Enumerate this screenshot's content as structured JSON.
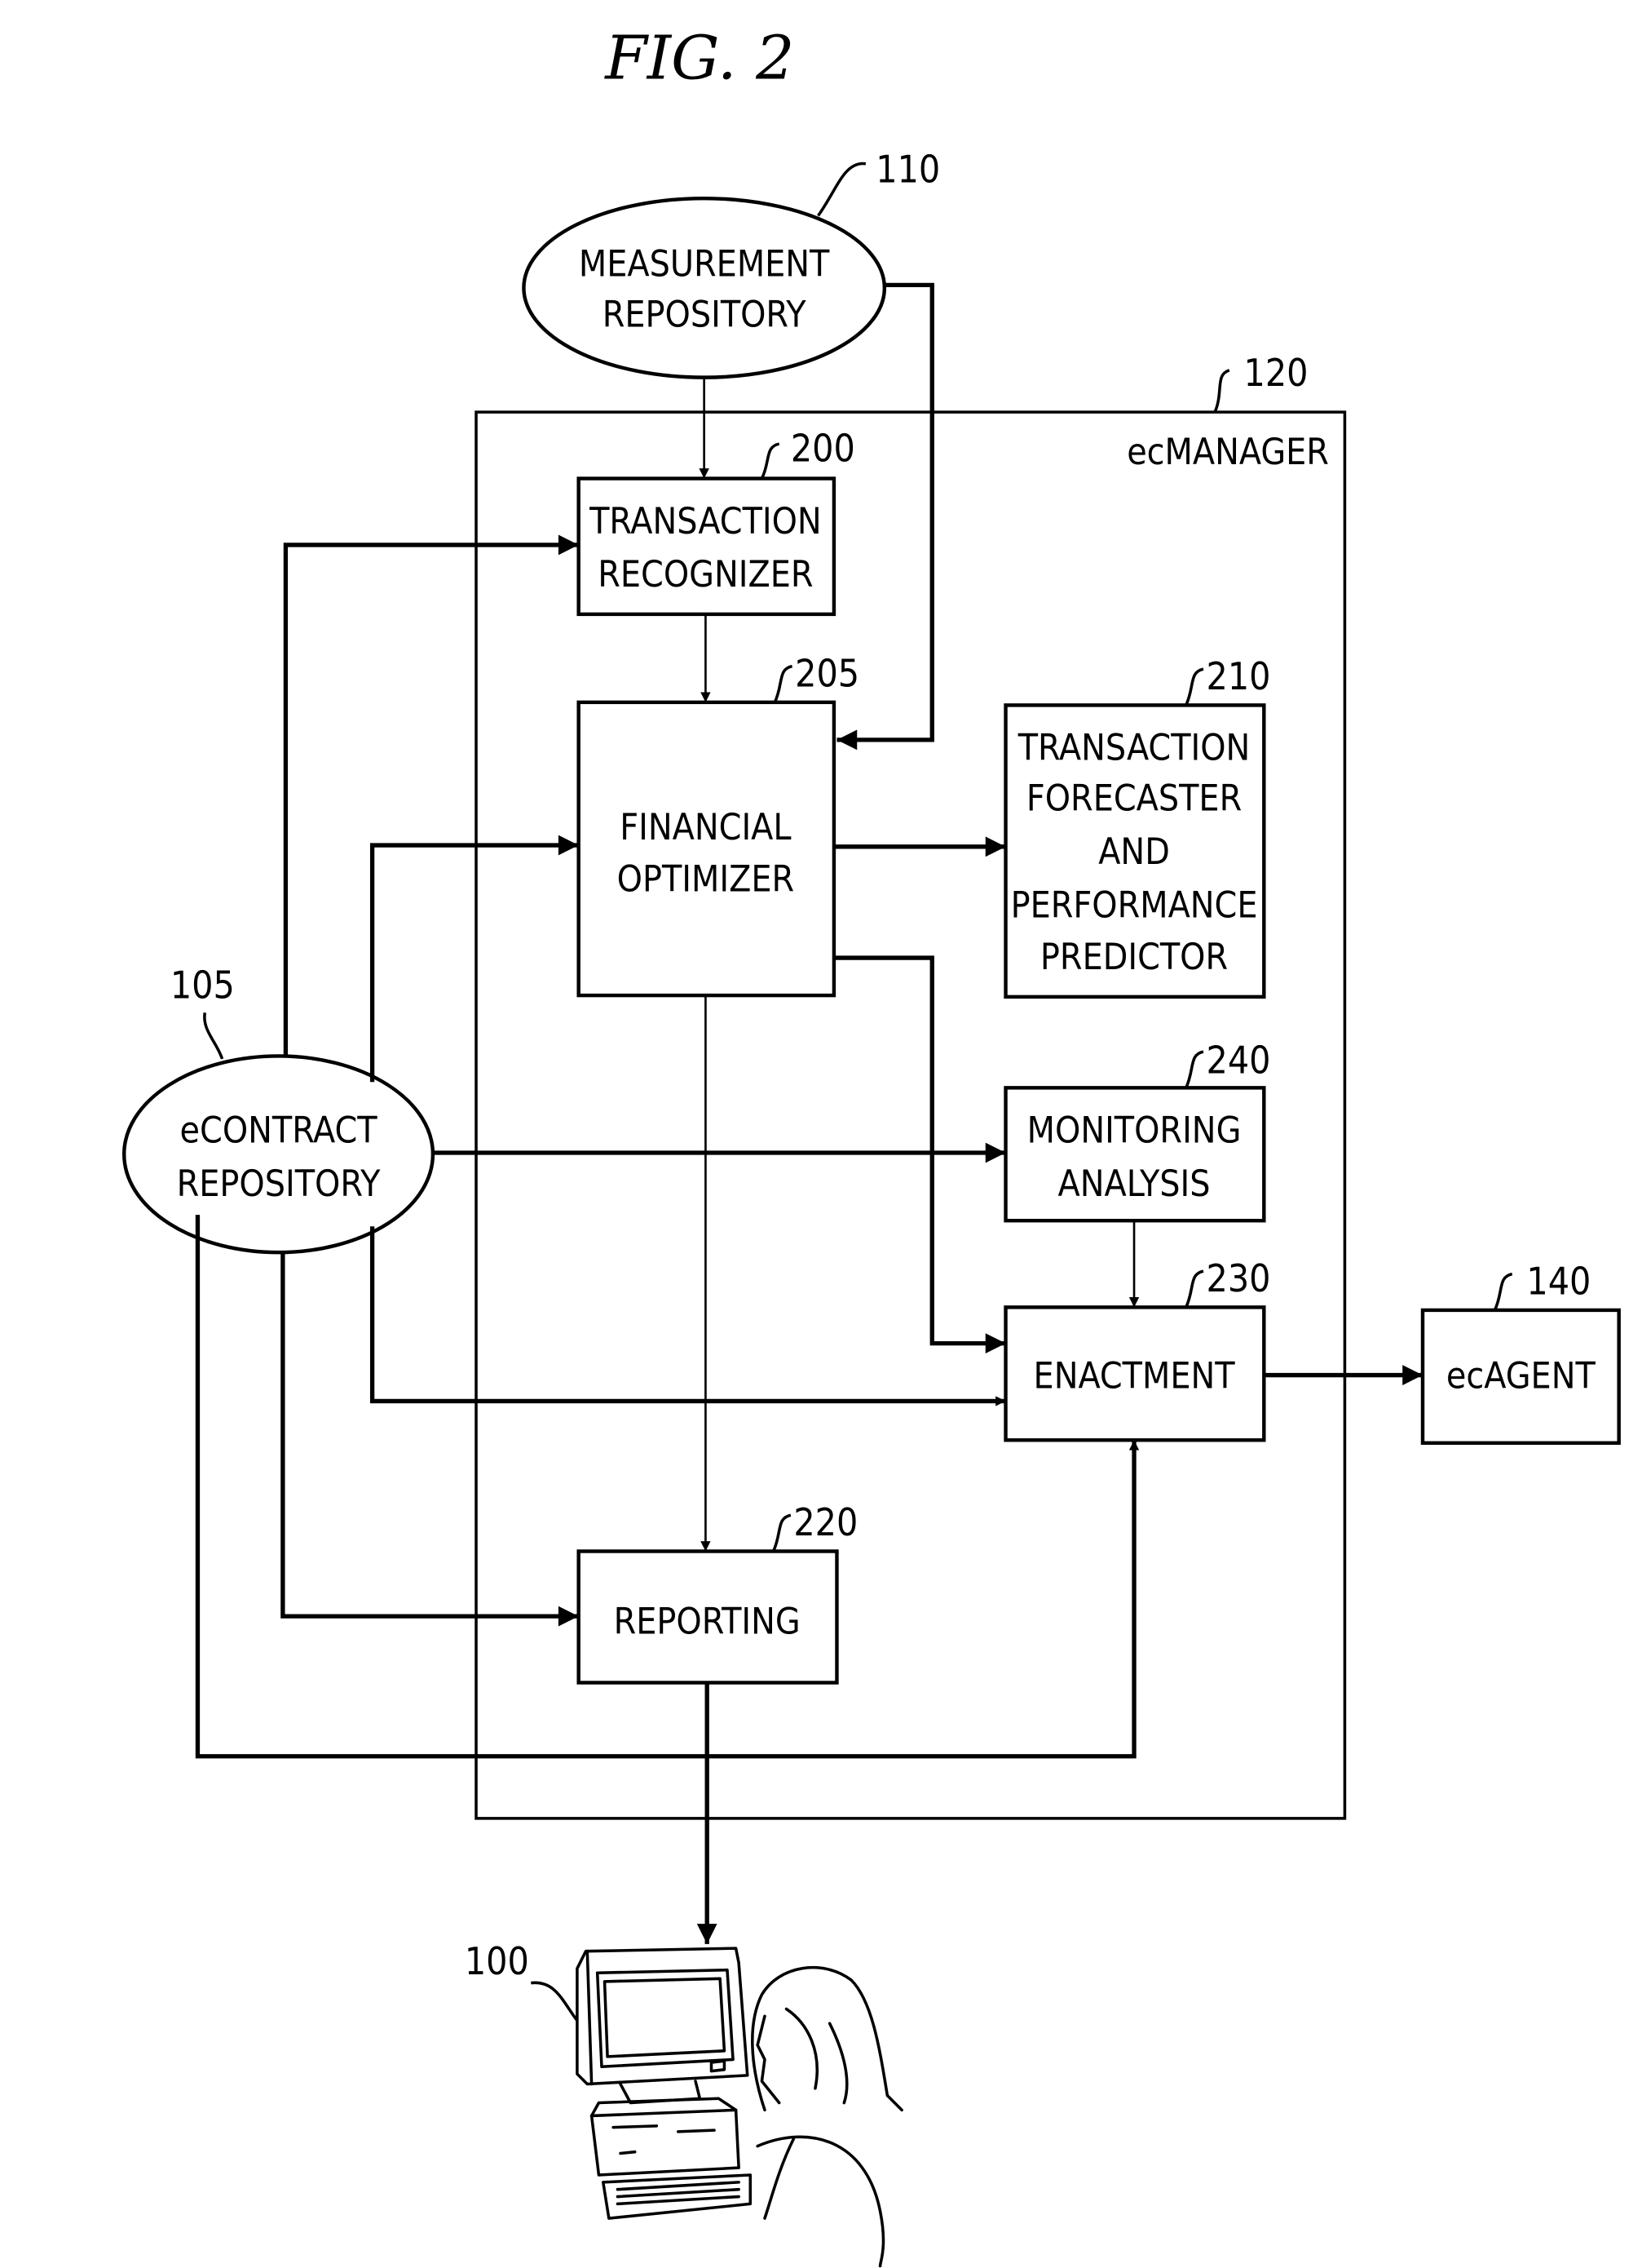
{
  "figure": {
    "title": "FIG. 2"
  },
  "nodes": {
    "measurement_repository": {
      "ref": "110",
      "lines": [
        "MEASUREMENT",
        "REPOSITORY"
      ]
    },
    "ecmanager": {
      "ref": "120",
      "label": "ecMANAGER"
    },
    "transaction_recognizer": {
      "ref": "200",
      "lines": [
        "TRANSACTION",
        "RECOGNIZER"
      ]
    },
    "financial_optimizer": {
      "ref": "205",
      "lines": [
        "FINANCIAL",
        "OPTIMIZER"
      ]
    },
    "transaction_forecaster": {
      "ref": "210",
      "lines": [
        "TRANSACTION",
        "FORECASTER",
        "AND",
        "PERFORMANCE",
        "PREDICTOR"
      ]
    },
    "monitoring_analysis": {
      "ref": "240",
      "lines": [
        "MONITORING",
        "ANALYSIS"
      ]
    },
    "enactment": {
      "ref": "230",
      "lines": [
        "ENACTMENT"
      ]
    },
    "ecagent": {
      "ref": "140",
      "lines": [
        "ecAGENT"
      ]
    },
    "reporting": {
      "ref": "220",
      "lines": [
        "REPORTING"
      ]
    },
    "econtract_repository": {
      "ref": "105",
      "lines": [
        "eCONTRACT",
        "REPOSITORY"
      ]
    },
    "user_terminal": {
      "ref": "100"
    }
  }
}
